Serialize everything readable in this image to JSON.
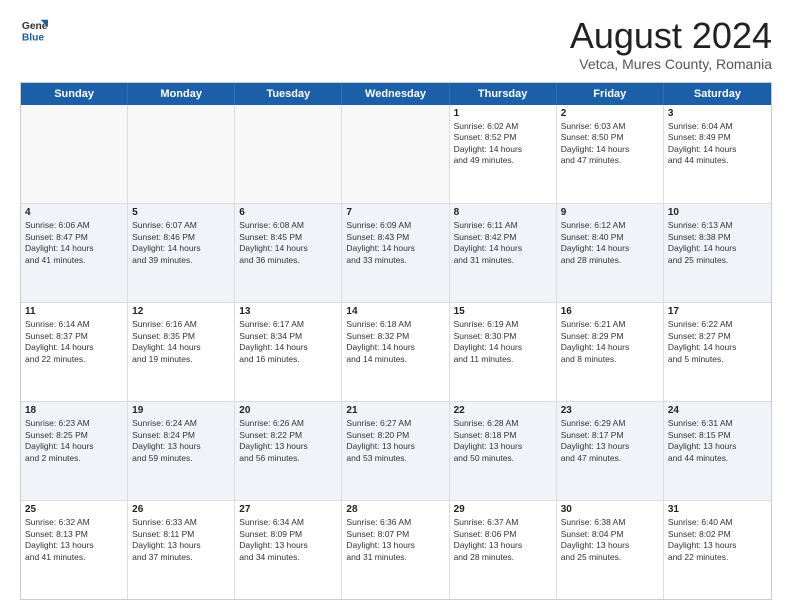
{
  "logo": {
    "line1": "General",
    "line2": "Blue"
  },
  "title": "August 2024",
  "subtitle": "Vetca, Mures County, Romania",
  "header_days": [
    "Sunday",
    "Monday",
    "Tuesday",
    "Wednesday",
    "Thursday",
    "Friday",
    "Saturday"
  ],
  "rows": [
    [
      {
        "day": "",
        "text": "",
        "empty": true
      },
      {
        "day": "",
        "text": "",
        "empty": true
      },
      {
        "day": "",
        "text": "",
        "empty": true
      },
      {
        "day": "",
        "text": "",
        "empty": true
      },
      {
        "day": "1",
        "text": "Sunrise: 6:02 AM\nSunset: 8:52 PM\nDaylight: 14 hours\nand 49 minutes."
      },
      {
        "day": "2",
        "text": "Sunrise: 6:03 AM\nSunset: 8:50 PM\nDaylight: 14 hours\nand 47 minutes."
      },
      {
        "day": "3",
        "text": "Sunrise: 6:04 AM\nSunset: 8:49 PM\nDaylight: 14 hours\nand 44 minutes."
      }
    ],
    [
      {
        "day": "4",
        "text": "Sunrise: 6:06 AM\nSunset: 8:47 PM\nDaylight: 14 hours\nand 41 minutes."
      },
      {
        "day": "5",
        "text": "Sunrise: 6:07 AM\nSunset: 8:46 PM\nDaylight: 14 hours\nand 39 minutes."
      },
      {
        "day": "6",
        "text": "Sunrise: 6:08 AM\nSunset: 8:45 PM\nDaylight: 14 hours\nand 36 minutes."
      },
      {
        "day": "7",
        "text": "Sunrise: 6:09 AM\nSunset: 8:43 PM\nDaylight: 14 hours\nand 33 minutes."
      },
      {
        "day": "8",
        "text": "Sunrise: 6:11 AM\nSunset: 8:42 PM\nDaylight: 14 hours\nand 31 minutes."
      },
      {
        "day": "9",
        "text": "Sunrise: 6:12 AM\nSunset: 8:40 PM\nDaylight: 14 hours\nand 28 minutes."
      },
      {
        "day": "10",
        "text": "Sunrise: 6:13 AM\nSunset: 8:38 PM\nDaylight: 14 hours\nand 25 minutes."
      }
    ],
    [
      {
        "day": "11",
        "text": "Sunrise: 6:14 AM\nSunset: 8:37 PM\nDaylight: 14 hours\nand 22 minutes."
      },
      {
        "day": "12",
        "text": "Sunrise: 6:16 AM\nSunset: 8:35 PM\nDaylight: 14 hours\nand 19 minutes."
      },
      {
        "day": "13",
        "text": "Sunrise: 6:17 AM\nSunset: 8:34 PM\nDaylight: 14 hours\nand 16 minutes."
      },
      {
        "day": "14",
        "text": "Sunrise: 6:18 AM\nSunset: 8:32 PM\nDaylight: 14 hours\nand 14 minutes."
      },
      {
        "day": "15",
        "text": "Sunrise: 6:19 AM\nSunset: 8:30 PM\nDaylight: 14 hours\nand 11 minutes."
      },
      {
        "day": "16",
        "text": "Sunrise: 6:21 AM\nSunset: 8:29 PM\nDaylight: 14 hours\nand 8 minutes."
      },
      {
        "day": "17",
        "text": "Sunrise: 6:22 AM\nSunset: 8:27 PM\nDaylight: 14 hours\nand 5 minutes."
      }
    ],
    [
      {
        "day": "18",
        "text": "Sunrise: 6:23 AM\nSunset: 8:25 PM\nDaylight: 14 hours\nand 2 minutes."
      },
      {
        "day": "19",
        "text": "Sunrise: 6:24 AM\nSunset: 8:24 PM\nDaylight: 13 hours\nand 59 minutes."
      },
      {
        "day": "20",
        "text": "Sunrise: 6:26 AM\nSunset: 8:22 PM\nDaylight: 13 hours\nand 56 minutes."
      },
      {
        "day": "21",
        "text": "Sunrise: 6:27 AM\nSunset: 8:20 PM\nDaylight: 13 hours\nand 53 minutes."
      },
      {
        "day": "22",
        "text": "Sunrise: 6:28 AM\nSunset: 8:18 PM\nDaylight: 13 hours\nand 50 minutes."
      },
      {
        "day": "23",
        "text": "Sunrise: 6:29 AM\nSunset: 8:17 PM\nDaylight: 13 hours\nand 47 minutes."
      },
      {
        "day": "24",
        "text": "Sunrise: 6:31 AM\nSunset: 8:15 PM\nDaylight: 13 hours\nand 44 minutes."
      }
    ],
    [
      {
        "day": "25",
        "text": "Sunrise: 6:32 AM\nSunset: 8:13 PM\nDaylight: 13 hours\nand 41 minutes."
      },
      {
        "day": "26",
        "text": "Sunrise: 6:33 AM\nSunset: 8:11 PM\nDaylight: 13 hours\nand 37 minutes."
      },
      {
        "day": "27",
        "text": "Sunrise: 6:34 AM\nSunset: 8:09 PM\nDaylight: 13 hours\nand 34 minutes."
      },
      {
        "day": "28",
        "text": "Sunrise: 6:36 AM\nSunset: 8:07 PM\nDaylight: 13 hours\nand 31 minutes."
      },
      {
        "day": "29",
        "text": "Sunrise: 6:37 AM\nSunset: 8:06 PM\nDaylight: 13 hours\nand 28 minutes."
      },
      {
        "day": "30",
        "text": "Sunrise: 6:38 AM\nSunset: 8:04 PM\nDaylight: 13 hours\nand 25 minutes."
      },
      {
        "day": "31",
        "text": "Sunrise: 6:40 AM\nSunset: 8:02 PM\nDaylight: 13 hours\nand 22 minutes."
      }
    ]
  ]
}
